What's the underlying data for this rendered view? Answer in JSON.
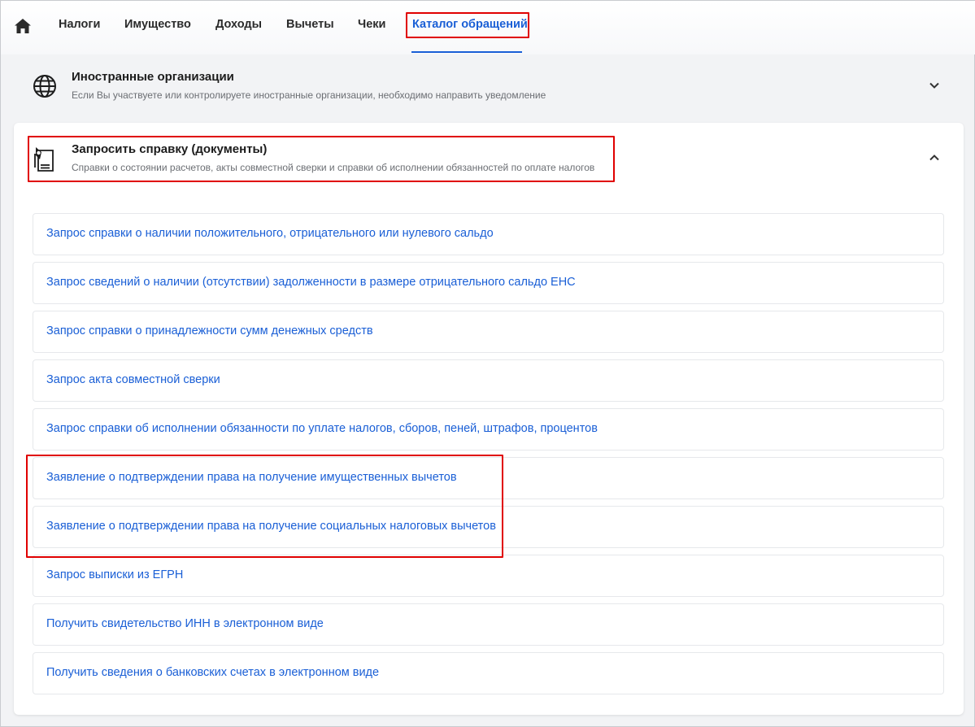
{
  "nav": {
    "items": [
      "Налоги",
      "Имущество",
      "Доходы",
      "Вычеты",
      "Чеки",
      "Каталог обращений"
    ],
    "active": "Каталог обращений"
  },
  "foreign": {
    "title": "Иностранные организации",
    "subtitle": "Если Вы участвуете или контролируете иностранные организации, необходимо направить уведомление"
  },
  "section": {
    "title": "Запросить справку (документы)",
    "subtitle": "Справки о состоянии расчетов, акты совместной сверки и справки об исполнении обязанностей по оплате налогов",
    "items": [
      "Запрос справки о наличии положительного, отрицательного или нулевого сальдо",
      "Запрос сведений о наличии (отсутствии) задолженности в размере отрицательного сальдо ЕНС",
      "Запрос справки о принадлежности сумм денежных средств",
      "Запрос акта совместной сверки",
      "Запрос справки об исполнении обязанности по уплате налогов, сборов, пеней, штрафов, процентов",
      "Заявление о подтверждении права на получение имущественных вычетов",
      "Заявление о подтверждении права на получение социальных налоговых вычетов",
      "Запрос выписки из ЕГРН",
      "Получить свидетельство ИНН в электронном виде",
      "Получить сведения о банковских счетах в электронном виде"
    ]
  },
  "colors": {
    "accent": "#1a5fd6",
    "highlight": "#e00000"
  },
  "icons": [
    "home-icon",
    "globe-icon",
    "chevron-down-icon",
    "document-icon",
    "chevron-up-icon"
  ]
}
